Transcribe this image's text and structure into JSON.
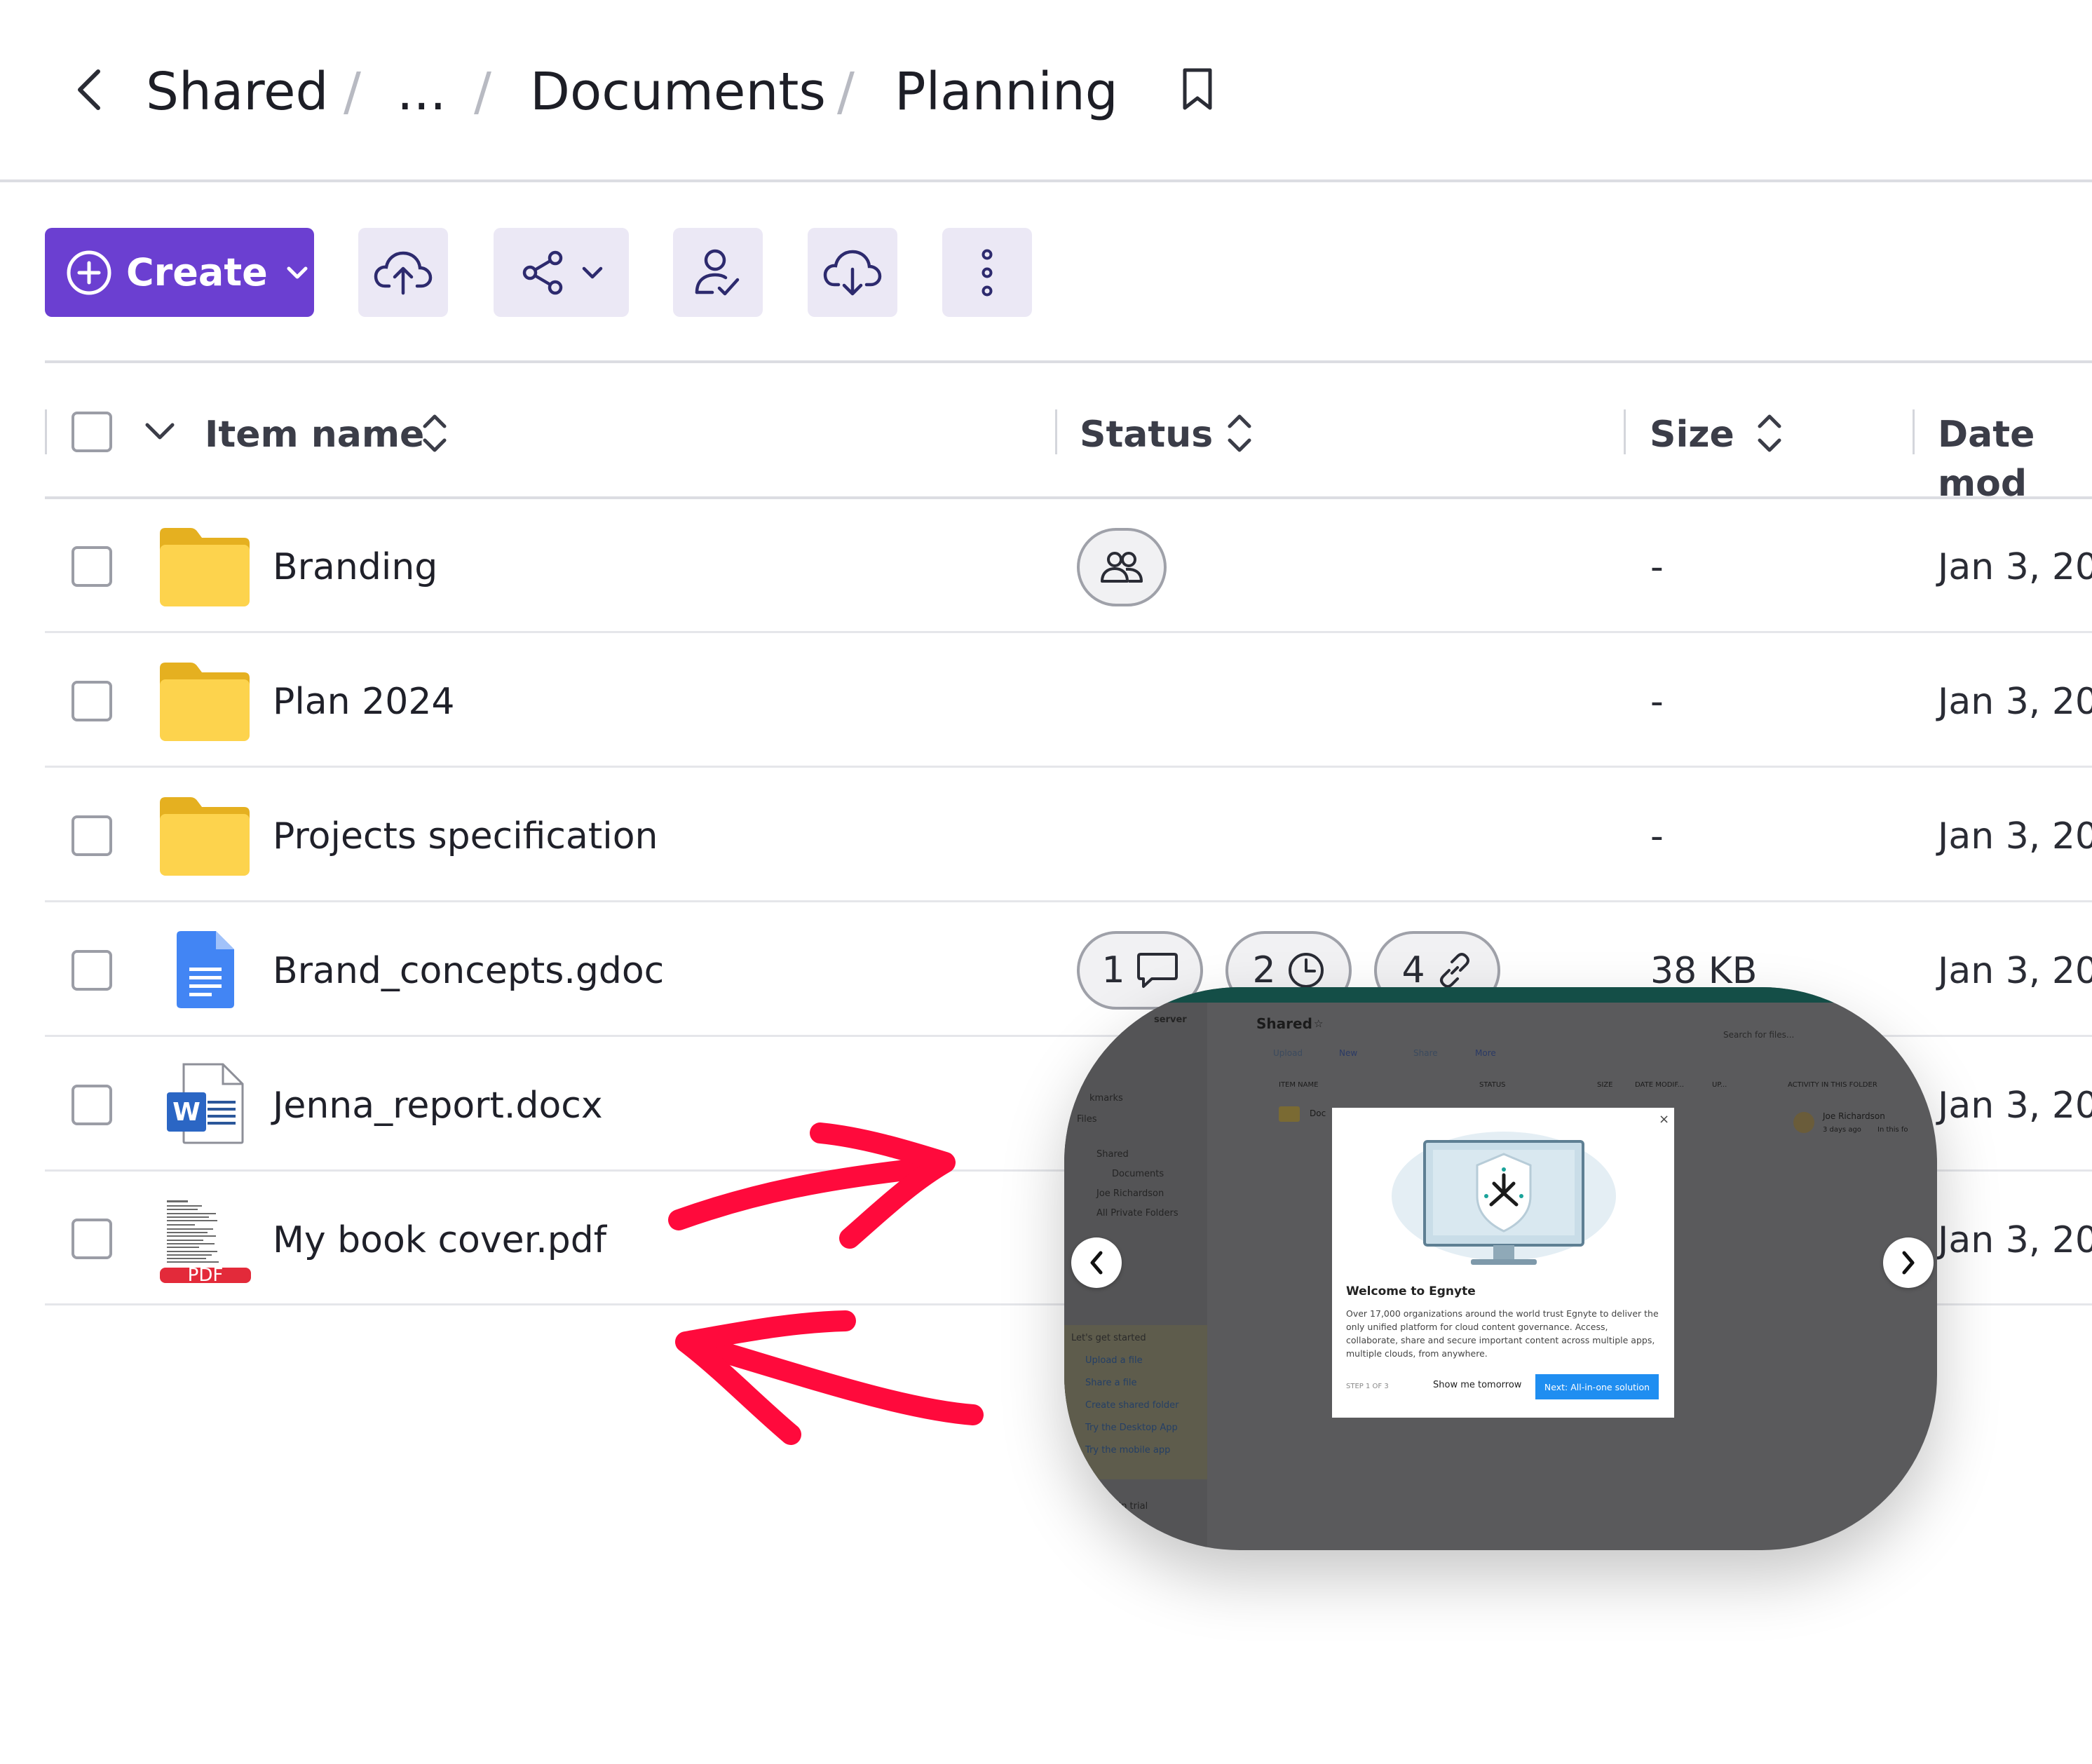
{
  "breadcrumb": {
    "items": [
      "Shared",
      "...",
      "Documents",
      "Planning"
    ],
    "separator": "/"
  },
  "toolbar": {
    "create_label": "Create",
    "icons": [
      "cloud-upload-icon",
      "share-icon",
      "user-check-icon",
      "cloud-download-icon",
      "more-vertical-icon"
    ]
  },
  "table": {
    "headers": {
      "name": "Item name",
      "status": "Status",
      "size": "Size",
      "date": "Date mod"
    },
    "rows": [
      {
        "name": "Branding",
        "type": "folder",
        "status": "shared-users",
        "size": "-",
        "date": "Jan 3, 20"
      },
      {
        "name": "Plan 2024",
        "type": "folder",
        "status": "",
        "size": "-",
        "date": "Jan 3, 20"
      },
      {
        "name": "Projects specification",
        "type": "folder",
        "status": "",
        "size": "-",
        "date": "Jan 3, 20"
      },
      {
        "name": "Brand_concepts.gdoc",
        "type": "gdoc",
        "status": "",
        "size": "38 KB",
        "date": "Jan 3, 20",
        "badges": [
          {
            "count": "1",
            "icon": "comment-icon"
          },
          {
            "count": "2",
            "icon": "clock-icon"
          },
          {
            "count": "4",
            "icon": "link-icon"
          }
        ]
      },
      {
        "name": "Jenna_report.docx",
        "type": "docx",
        "status": "",
        "size": "",
        "date": "Jan 3, 20"
      },
      {
        "name": "My book cover.pdf",
        "type": "pdf",
        "status": "",
        "size": "",
        "date": "Jan 3, 20",
        "pdf_label": "PDF"
      }
    ]
  },
  "preview": {
    "sidebar": [
      "server",
      "kmarks",
      "Files",
      "Shared",
      "Documents",
      "Joe Richardson",
      "All Private Folders"
    ],
    "getting_started": [
      "Let's get started",
      "Upload a file",
      "Share a file",
      "Create shared folder",
      "Try the Desktop App",
      "Try the mobile app",
      "ft in trial"
    ],
    "title": "Shared",
    "search_placeholder": "Search for files...",
    "actions": [
      "Upload",
      "New",
      "Share",
      "More"
    ],
    "columns": [
      "ITEM NAME",
      "STATUS",
      "SIZE",
      "DATE MODIF...",
      "UP...",
      "ACTIVITY IN THIS FOLDER"
    ],
    "first_row": "Doc",
    "activity": {
      "who": "Joe Richardson",
      "when": "3 days ago",
      "where": "In this fo"
    },
    "dialog": {
      "title": "Welcome to Egnyte",
      "body": "Over 17,000 organizations around the world trust Egnyte to deliver the only unified platform for cloud content governance. Access, collaborate, share and secure important content across multiple apps, multiple clouds, from anywhere.",
      "step": "STEP 1 OF 3",
      "later": "Show me tomorrow",
      "next": "Next: All-in-one solution"
    }
  },
  "colors": {
    "accent": "#6b3fd1",
    "toolbar_button_bg": "#ebe8f5",
    "folder": "#fdd34d",
    "annotation_arrow": "#ff0a3c"
  }
}
